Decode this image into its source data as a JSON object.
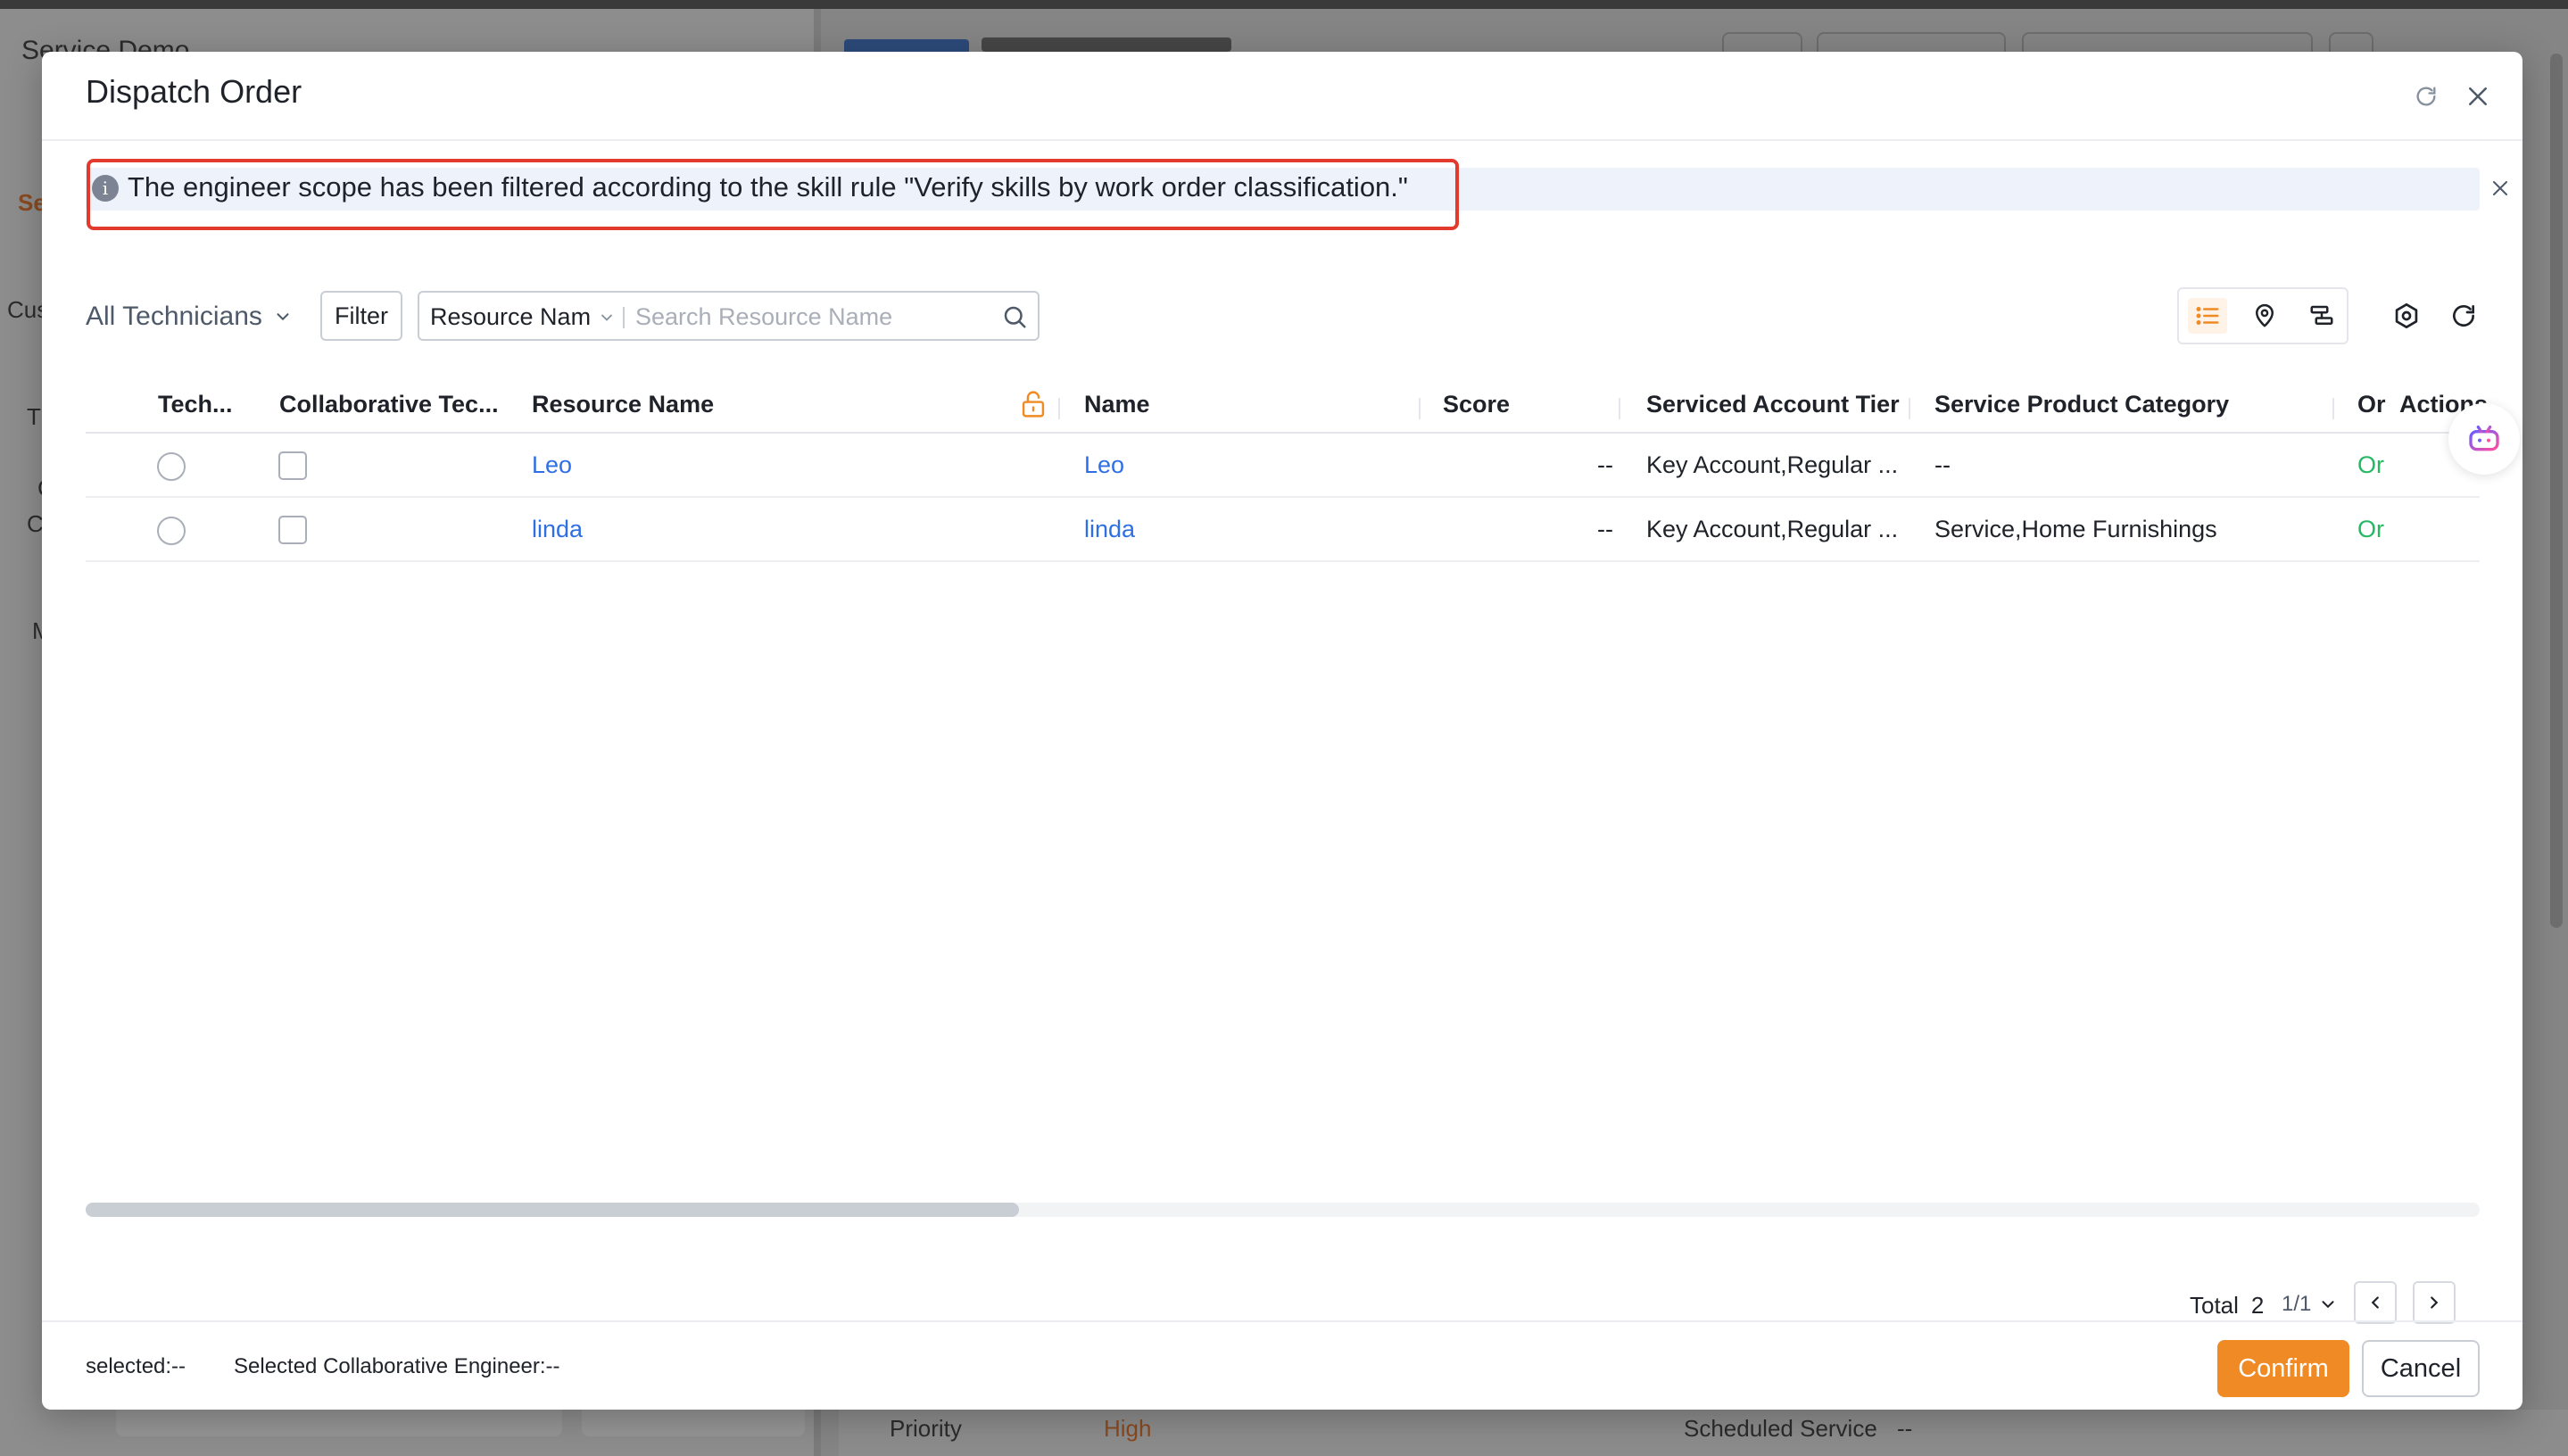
{
  "background": {
    "app_title": "Service Demo",
    "side_labels": [
      "Se",
      "Cus",
      "T",
      "C",
      "C",
      "M"
    ],
    "priority_label": "Priority",
    "priority_value": "High",
    "scheduled_label": "Scheduled Service",
    "scheduled_value": "--"
  },
  "modal": {
    "title": "Dispatch Order",
    "alert_text": "The engineer scope has been filtered according to the skill rule \"Verify skills by work order classification.\"",
    "toolbar": {
      "technician_scope": "All Technicians",
      "filter_label": "Filter",
      "search_field": "Resource Nam",
      "search_placeholder": "Search Resource Name"
    },
    "table": {
      "columns": {
        "technician": "Tech...",
        "collaborative": "Collaborative Tec...",
        "resource_name": "Resource Name",
        "name": "Name",
        "score": "Score",
        "account_tier": "Serviced Account Tier",
        "product_category": "Service Product Category",
        "status": "Or",
        "actions": "Actions"
      },
      "rows": [
        {
          "resource_name": "Leo",
          "name": "Leo",
          "score": "--",
          "account_tier": "Key Account,Regular ...",
          "product_category": "--",
          "status": "Or"
        },
        {
          "resource_name": "linda",
          "name": "linda",
          "score": "--",
          "account_tier": "Key Account,Regular ...",
          "product_category": "Service,Home Furnishings",
          "status": "Or"
        }
      ]
    },
    "pagination": {
      "total_label": "Total",
      "total_count": "2",
      "page": "1/1"
    },
    "footer": {
      "selected": "selected:--",
      "selected_collab": "Selected Collaborative Engineer:--",
      "confirm_label": "Confirm",
      "cancel_label": "Cancel"
    }
  },
  "colors": {
    "accent": "#f08a24",
    "link": "#2f6fe4",
    "status_green": "#25b864",
    "highlight_border": "#e23b2e"
  },
  "icons": [
    "refresh-icon",
    "close-icon",
    "info-icon",
    "chevron-down-icon",
    "search-icon",
    "list-view-icon",
    "map-pin-icon",
    "gantt-view-icon",
    "settings-icon",
    "lock-icon",
    "chevron-left-icon",
    "chevron-right-icon",
    "ai-assistant-icon"
  ]
}
